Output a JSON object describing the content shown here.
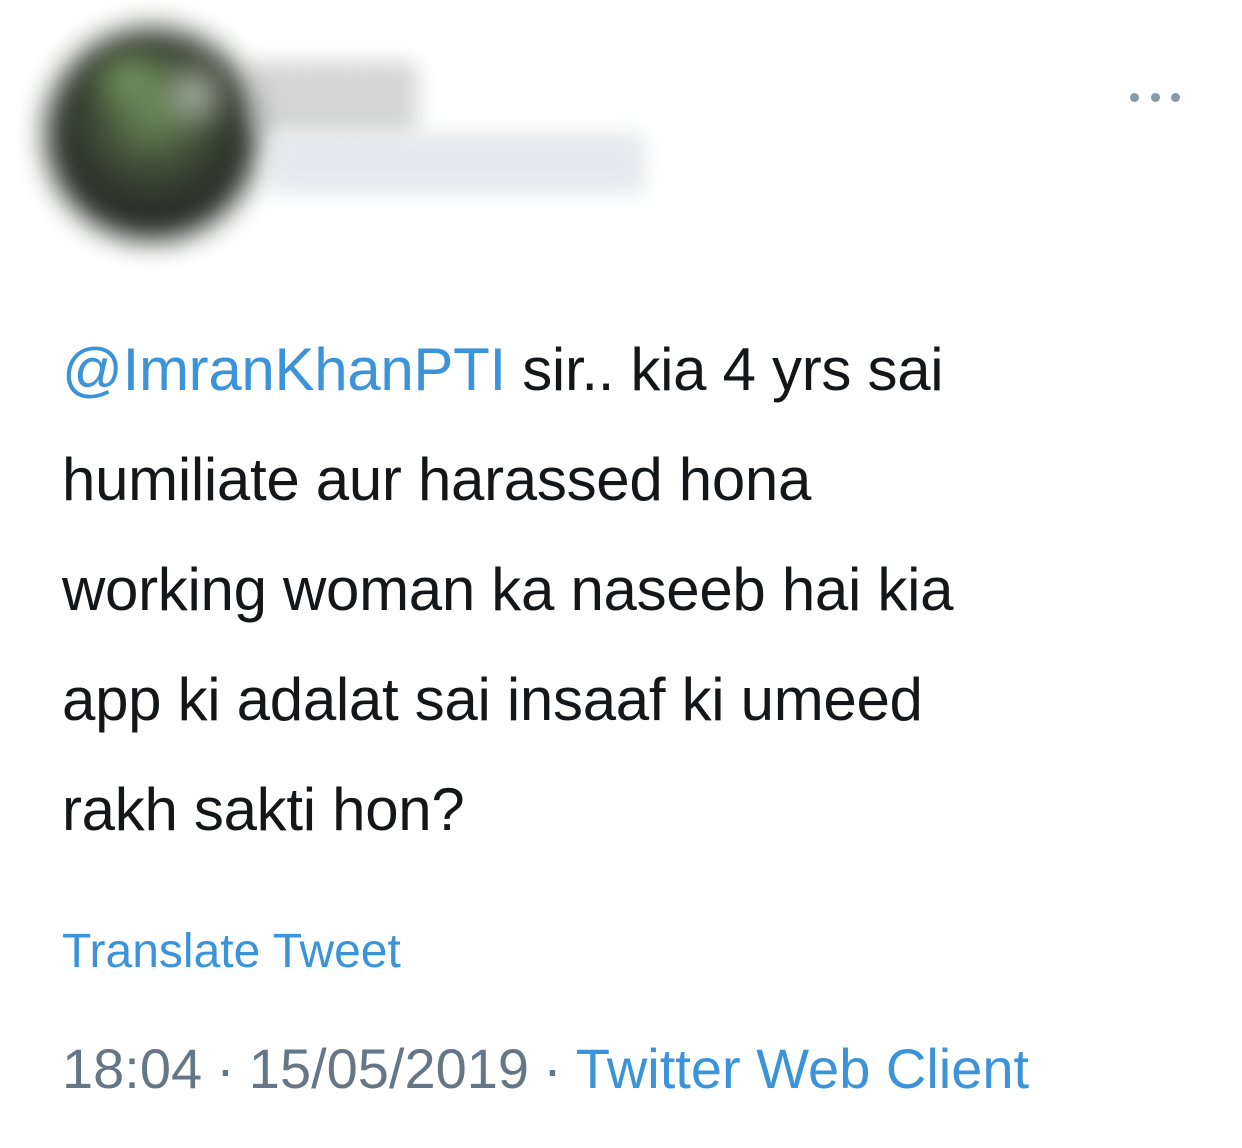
{
  "header": {
    "more_icon": "more-horizontal-icon"
  },
  "tweet": {
    "mention": "@ImranKhanPTI",
    "text_line1_rest": " sir.. kia 4 yrs sai",
    "text_line2": "humiliate aur harassed hona",
    "text_line3": "working woman ka naseeb hai kia",
    "text_line4": "app ki adalat sai insaaf ki umeed",
    "text_line5": "rakh sakti hon?",
    "translate_label": "Translate Tweet",
    "time": "18:04",
    "separator": "·",
    "date": "15/05/2019",
    "source": "Twitter Web Client"
  },
  "colors": {
    "link": "#3b94d9",
    "text": "#14171a",
    "meta": "#657786"
  }
}
